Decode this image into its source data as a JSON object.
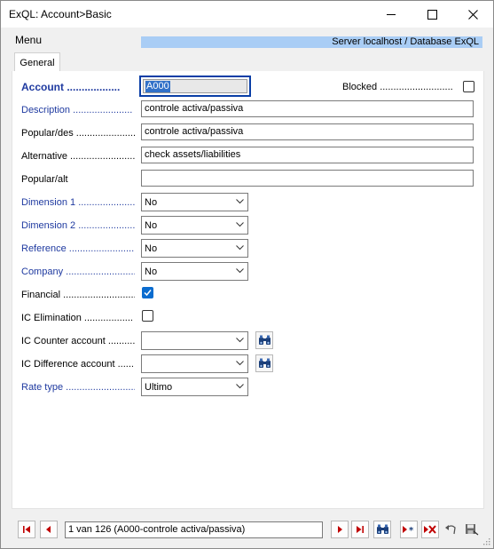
{
  "window": {
    "title": "ExQL: Account>Basic"
  },
  "menubar": {
    "menu_label": "Menu",
    "server_info": "Server localhost / Database ExQL"
  },
  "tabs": [
    {
      "label": "General",
      "active": true
    }
  ],
  "form": {
    "account": {
      "label": "Account ..................",
      "value": "A000"
    },
    "blocked": {
      "label": "Blocked .............................",
      "checked": false
    },
    "description": {
      "label": "Description ......................",
      "value": "controle activa/passiva"
    },
    "popular_des": {
      "label": "Popular/des .......................",
      "value": "controle activa/passiva"
    },
    "alternative": {
      "label": "Alternative .........................",
      "value": "check assets/liabilities"
    },
    "popular_alt": {
      "label": "Popular/alt",
      "value": ""
    },
    "dimension1": {
      "label": "Dimension 1 ......................",
      "value": "No"
    },
    "dimension2": {
      "label": "Dimension 2 ......................",
      "value": "No"
    },
    "reference": {
      "label": "Reference ..........................",
      "value": "No"
    },
    "company": {
      "label": "Company ...........................",
      "value": "No"
    },
    "financial": {
      "label": "Financial ...........................",
      "checked": true
    },
    "ic_elimination": {
      "label": "IC Elimination ..................",
      "checked": false
    },
    "ic_counter_account": {
      "label": "IC Counter account ..........",
      "value": ""
    },
    "ic_difference_account": {
      "label": "IC Difference account .......",
      "value": ""
    },
    "rate_type": {
      "label": "Rate type ..........................",
      "value": "Ultimo"
    }
  },
  "navigator": {
    "record_text": "1 van 126 (A000-controle activa/passiva)"
  },
  "colors": {
    "label_blue": "#1f3aa0",
    "server_bar": "#a9cdf5",
    "focus_border": "#0a3ea6",
    "check_blue": "#0a6ccf"
  }
}
